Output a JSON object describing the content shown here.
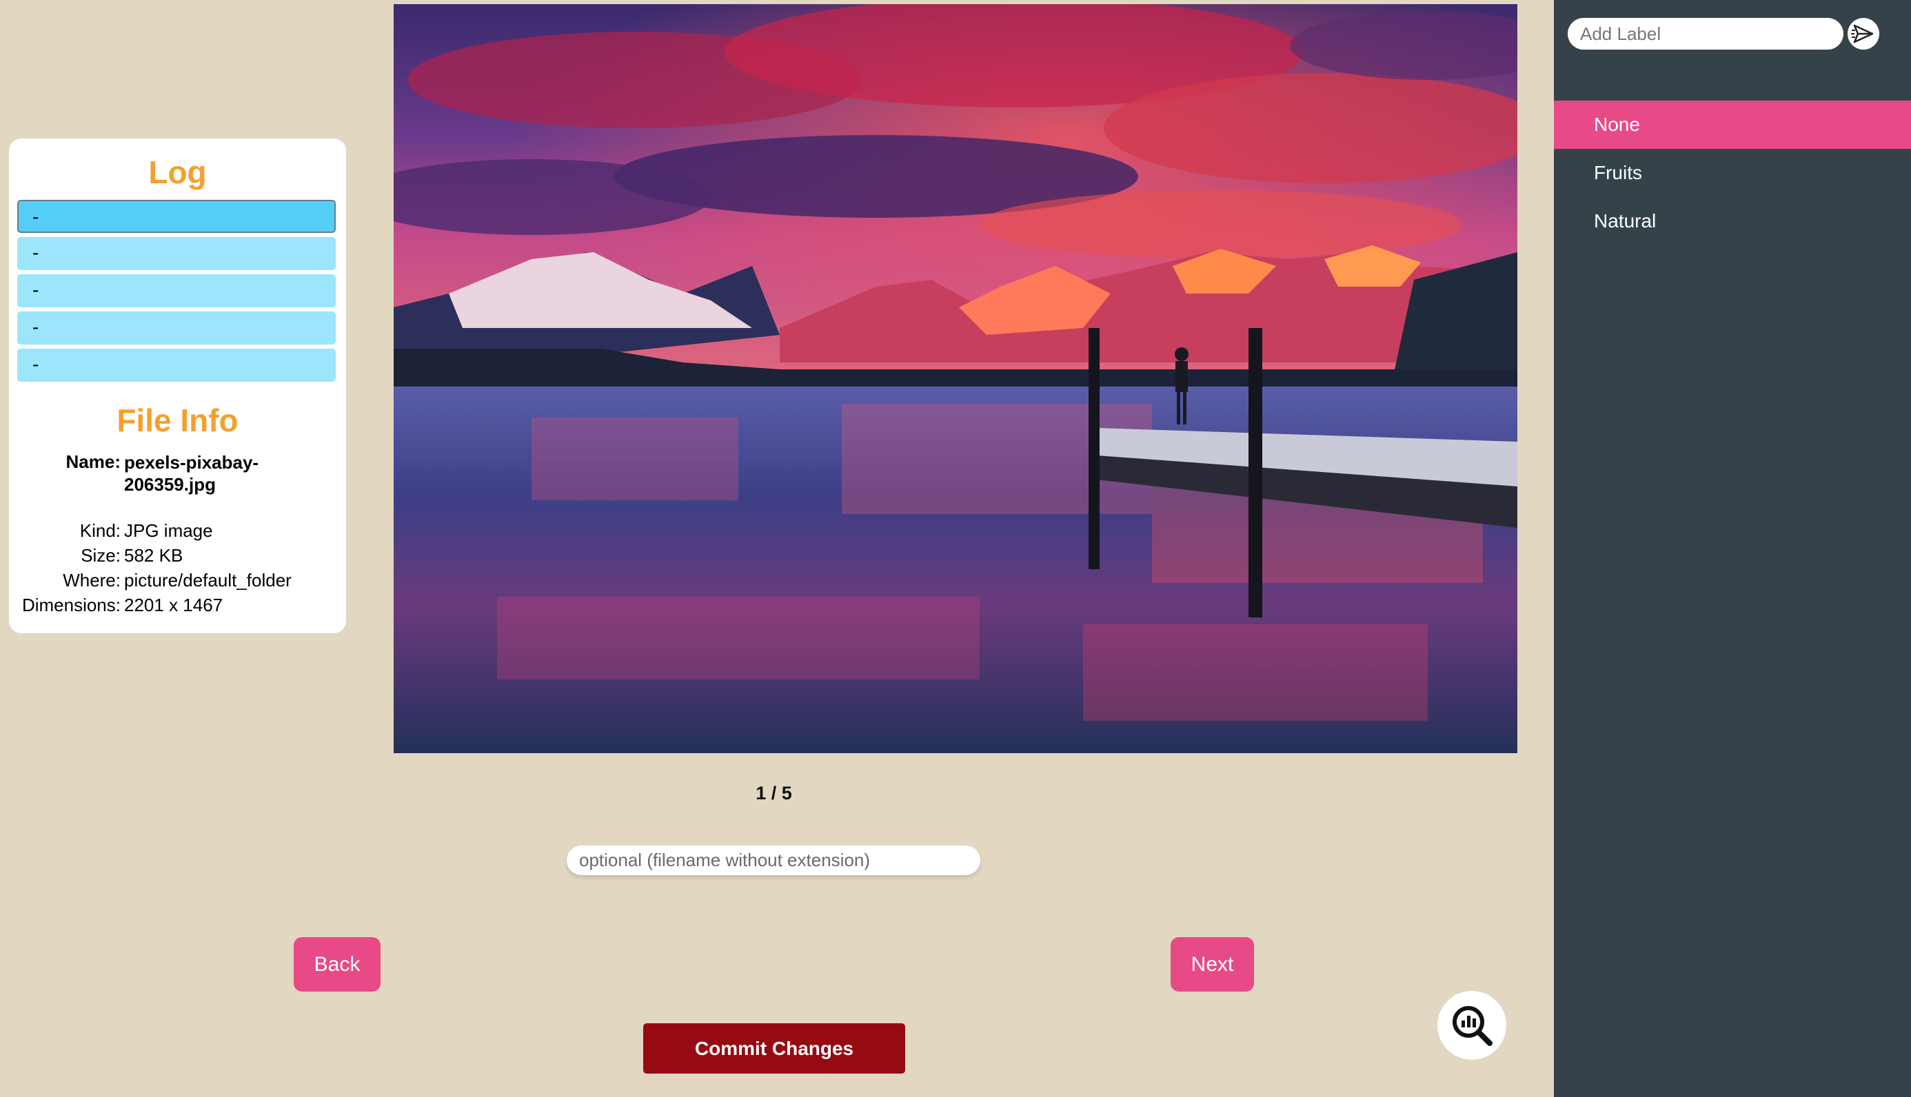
{
  "log": {
    "title": "Log",
    "entries": [
      "-",
      "-",
      "-",
      "-",
      "-"
    ]
  },
  "file_info": {
    "title": "File Info",
    "name_label": "Name:",
    "name_value": "pexels-pixabay-206359.jpg",
    "kind_label": "Kind:",
    "kind_value": "JPG image",
    "size_label": "Size:",
    "size_value": "582 KB",
    "where_label": "Where:",
    "where_value": "picture/default_folder",
    "dimensions_label": "Dimensions:",
    "dimensions_value": "2201 x 1467"
  },
  "viewer": {
    "counter": "1 / 5",
    "filename_placeholder": "optional (filename without extension)",
    "back_label": "Back",
    "next_label": "Next",
    "commit_label": "Commit Changes",
    "analytics_icon": "analytics-search-icon"
  },
  "sidebar": {
    "add_label_placeholder": "Add Label",
    "send_icon": "send-icon",
    "labels": [
      {
        "label": "None",
        "selected": true
      },
      {
        "label": "Fruits",
        "selected": false
      },
      {
        "label": "Natural",
        "selected": false
      }
    ]
  },
  "colors": {
    "background": "#e2d7c1",
    "accent_pink": "#e84a87",
    "title_orange": "#f4a02e",
    "commit_red": "#960b12",
    "sidebar_bg": "#36424a",
    "log_item": "#9be5fd",
    "log_item_active": "#55cef7"
  }
}
